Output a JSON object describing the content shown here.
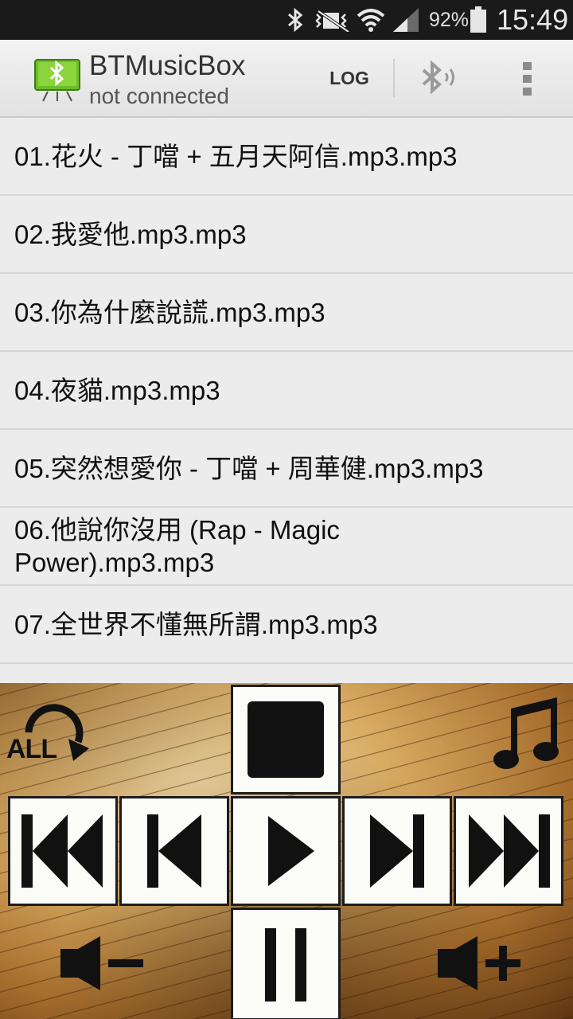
{
  "status_bar": {
    "battery_percent": "92%",
    "time": "15:49",
    "icons": [
      "bluetooth-icon",
      "mute-vibrate-icon",
      "wifi-icon",
      "signal-icon",
      "battery-icon"
    ]
  },
  "action_bar": {
    "title": "BTMusicBox",
    "subtitle": "not connected",
    "log_label": "LOG",
    "icons": [
      "app-bluetooth-icon",
      "bluetooth-connect-icon",
      "overflow-menu-icon"
    ]
  },
  "songs": [
    "01.花火 - 丁噹 + 五月天阿信.mp3.mp3",
    "02.我愛他.mp3.mp3",
    "03.你為什麼說謊.mp3.mp3",
    "04.夜貓.mp3.mp3",
    "05.突然想愛你 - 丁噹 + 周華健.mp3.mp3",
    "06.他說你沒用 (Rap - Magic Power).mp3.mp3",
    "07.全世界不懂無所謂.mp3.mp3"
  ],
  "player": {
    "repeat_label": "ALL",
    "controls": [
      "stop-icon",
      "skip-back-icon",
      "previous-icon",
      "play-icon",
      "next-icon",
      "skip-forward-icon",
      "pause-icon",
      "volume-down-icon",
      "volume-up-icon",
      "music-note-icon"
    ],
    "colors": {
      "button_bg": "#fbfbf8",
      "icon": "#111111",
      "parchment": "#d9ac64"
    }
  }
}
